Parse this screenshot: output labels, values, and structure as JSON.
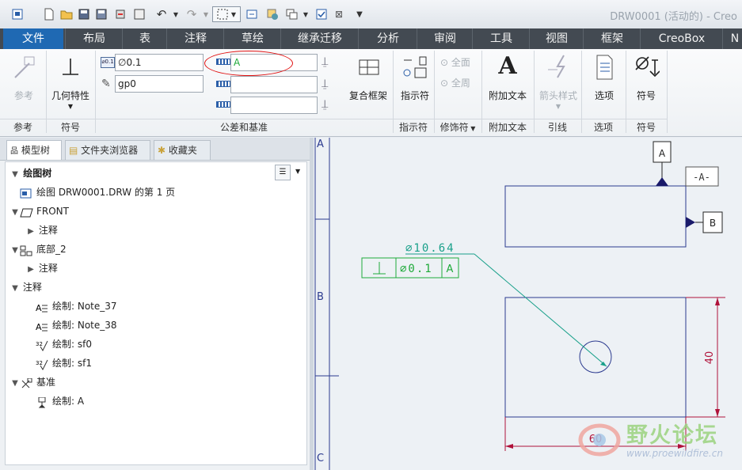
{
  "window": {
    "title": "DRW0001 (活动的) - Creo"
  },
  "quick_access": [
    "new-icon",
    "open-icon",
    "save-icon",
    "save-as-icon",
    "regenerate-icon",
    "close-window-icon",
    "undo-icon",
    "redo-icon",
    "select-box-icon",
    "switch-window-icon",
    "windows-icon",
    "check-icon",
    "close-icon",
    "customize-icon"
  ],
  "tabs": [
    {
      "label": "文件"
    },
    {
      "label": "布局"
    },
    {
      "label": "表"
    },
    {
      "label": "注释"
    },
    {
      "label": "草绘"
    },
    {
      "label": "继承迁移"
    },
    {
      "label": "分析"
    },
    {
      "label": "审阅"
    },
    {
      "label": "工具"
    },
    {
      "label": "视图"
    },
    {
      "label": "框架"
    },
    {
      "label": "CreoBox"
    },
    {
      "label": "N"
    }
  ],
  "ribbon": {
    "reference": {
      "button": "参考",
      "group": "参考"
    },
    "symbol": {
      "button": "几何特性",
      "group": "符号"
    },
    "tolerance": {
      "tolerance_value": "∅0.1",
      "symbol_text": "gp0",
      "datum_primary": "A",
      "datum_secondary": "",
      "datum_tertiary": "",
      "group": "公差和基准"
    },
    "composite_frame": {
      "button": "复合框架"
    },
    "indicator": {
      "button": "指示符",
      "group": "指示符"
    },
    "modifier": {
      "all_around_1": "全面",
      "all_around_2": "全周",
      "group": "修饰符"
    },
    "additional_text": {
      "button": "附加文本",
      "group": "附加文本"
    },
    "leader": {
      "button": "箭头样式",
      "group": "引线"
    },
    "options": {
      "button": "选项",
      "group": "选项"
    },
    "symbol2": {
      "button": "符号",
      "group": "符号"
    }
  },
  "left_panel": {
    "tabs": [
      {
        "label": "模型树"
      },
      {
        "label": "文件夹浏览器"
      },
      {
        "label": "收藏夹"
      }
    ],
    "tree_header": "绘图树",
    "tree": [
      {
        "label": "绘图 DRW0001.DRW 的第 1 页",
        "level": 0,
        "toggle": "",
        "icon": "drawing-page-icon"
      },
      {
        "label": "FRONT",
        "level": 0,
        "toggle": "▼",
        "icon": "plane-icon"
      },
      {
        "label": "注释",
        "level": 1,
        "toggle": "▶",
        "icon": ""
      },
      {
        "label": "底部_2",
        "level": 0,
        "toggle": "▼",
        "icon": "view-icon"
      },
      {
        "label": "注释",
        "level": 1,
        "toggle": "▶",
        "icon": ""
      },
      {
        "label": "注释",
        "level": 0,
        "toggle": "▼",
        "icon": ""
      },
      {
        "label": "绘制: Note_37",
        "level": 1,
        "toggle": "",
        "icon": "note-icon"
      },
      {
        "label": "绘制: Note_38",
        "level": 1,
        "toggle": "",
        "icon": "note-icon"
      },
      {
        "label": "绘制: sf0",
        "level": 1,
        "toggle": "",
        "icon": "surface-finish-icon"
      },
      {
        "label": "绘制: sf1",
        "level": 1,
        "toggle": "",
        "icon": "surface-finish-icon"
      },
      {
        "label": "基准",
        "level": 0,
        "toggle": "▼",
        "icon": "datum-icon"
      },
      {
        "label": "绘制: A",
        "level": 1,
        "toggle": "",
        "icon": "datum-feature-icon"
      }
    ]
  },
  "drawing": {
    "zone_labels": [
      "A",
      "B",
      "C"
    ],
    "datum_A": "A",
    "datum_B": "B",
    "datum_flag": "-A-",
    "diameter_dim": "∅10.64",
    "fcf": {
      "symbol": "⊥",
      "tolerance": "∅0.1",
      "datum": "A"
    },
    "height_dim": "40",
    "width_dim": "60",
    "colors": {
      "geometry": "#2b3a8f",
      "gtol": "#1faa3a",
      "leader": "#19a08a",
      "dimension": "#b0123a"
    }
  },
  "watermark": {
    "text": "野火论坛",
    "url": "www.proewildfire.cn"
  }
}
